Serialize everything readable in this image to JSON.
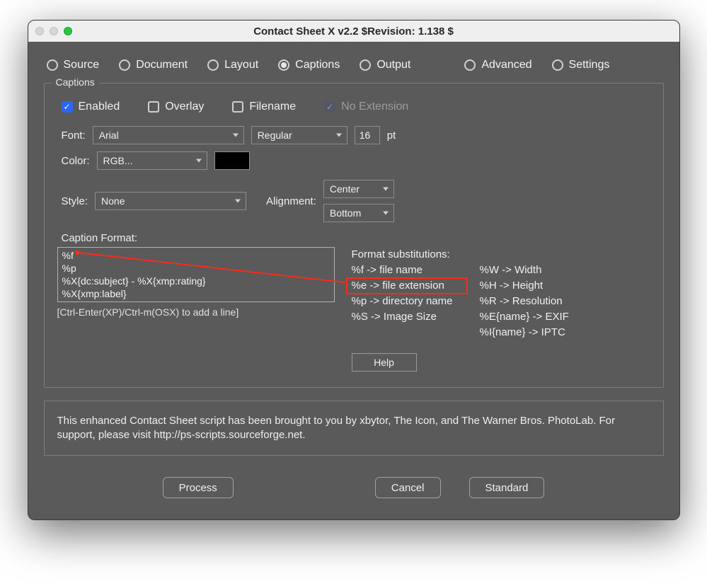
{
  "window": {
    "title": "Contact Sheet X v2.2 $Revision: 1.138 $"
  },
  "tabs": {
    "source": "Source",
    "document": "Document",
    "layout": "Layout",
    "captions": "Captions",
    "output": "Output",
    "advanced": "Advanced",
    "settings": "Settings",
    "selected": "captions"
  },
  "captions": {
    "legend": "Captions",
    "checkboxes": {
      "enabled": {
        "label": "Enabled",
        "checked": true,
        "disabled": false
      },
      "overlay": {
        "label": "Overlay",
        "checked": false,
        "disabled": false
      },
      "filename": {
        "label": "Filename",
        "checked": false,
        "disabled": false
      },
      "no_extension": {
        "label": "No Extension",
        "checked": true,
        "disabled": true
      }
    },
    "font": {
      "label": "Font:",
      "family": "Arial",
      "weight": "Regular",
      "size": "16",
      "unit": "pt"
    },
    "color": {
      "label": "Color:",
      "mode": "RGB...",
      "swatch": "#000000"
    },
    "style": {
      "label": "Style:",
      "value": "None"
    },
    "alignment": {
      "label": "Alignment:",
      "h": "Center",
      "v": "Bottom"
    },
    "caption_format": {
      "label": "Caption Format:",
      "lines": "%f\n%p\n%X{dc:subject} - %X{xmp:rating}\n%X{xmp:label}",
      "hint": "[Ctrl-Enter(XP)/Ctrl-m(OSX) to add a line]"
    },
    "substitutions": {
      "title": "Format substitutions:",
      "col1": [
        "%f -> file name",
        "%e -> file extension",
        "%p -> directory name",
        "%S -> Image Size"
      ],
      "col2": [
        "%W -> Width",
        "%H  -> Height",
        "%R  -> Resolution",
        "%E{name} -> EXIF",
        "%I{name} -> IPTC"
      ]
    },
    "help": "Help"
  },
  "info": {
    "text": "This enhanced Contact Sheet script has been brought to you by xbytor, The Icon, and The Warner Bros. PhotoLab. For support, please visit http://ps-scripts.sourceforge.net."
  },
  "buttons": {
    "process": "Process",
    "cancel": "Cancel",
    "standard": "Standard"
  }
}
